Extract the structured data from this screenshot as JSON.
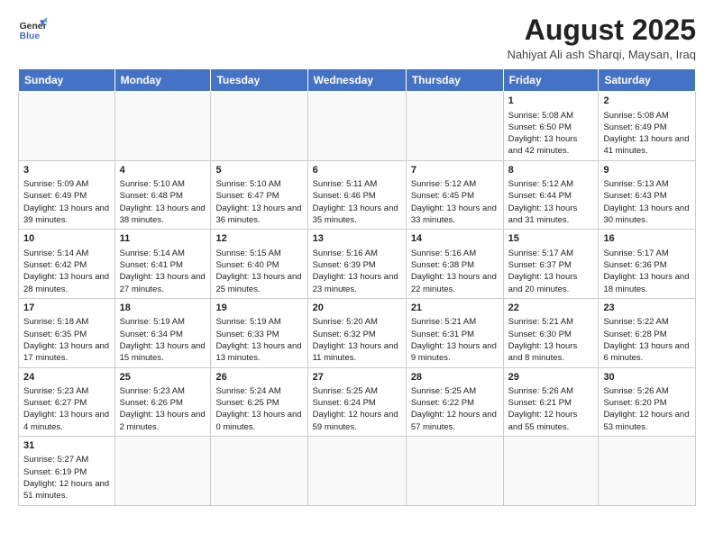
{
  "header": {
    "logo_general": "General",
    "logo_blue": "Blue",
    "title": "August 2025",
    "subtitle": "Nahiyat Ali ash Sharqi, Maysan, Iraq"
  },
  "days_of_week": [
    "Sunday",
    "Monday",
    "Tuesday",
    "Wednesday",
    "Thursday",
    "Friday",
    "Saturday"
  ],
  "weeks": [
    [
      {
        "day": "",
        "info": ""
      },
      {
        "day": "",
        "info": ""
      },
      {
        "day": "",
        "info": ""
      },
      {
        "day": "",
        "info": ""
      },
      {
        "day": "",
        "info": ""
      },
      {
        "day": "1",
        "info": "Sunrise: 5:08 AM\nSunset: 6:50 PM\nDaylight: 13 hours and 42 minutes."
      },
      {
        "day": "2",
        "info": "Sunrise: 5:08 AM\nSunset: 6:49 PM\nDaylight: 13 hours and 41 minutes."
      }
    ],
    [
      {
        "day": "3",
        "info": "Sunrise: 5:09 AM\nSunset: 6:49 PM\nDaylight: 13 hours and 39 minutes."
      },
      {
        "day": "4",
        "info": "Sunrise: 5:10 AM\nSunset: 6:48 PM\nDaylight: 13 hours and 38 minutes."
      },
      {
        "day": "5",
        "info": "Sunrise: 5:10 AM\nSunset: 6:47 PM\nDaylight: 13 hours and 36 minutes."
      },
      {
        "day": "6",
        "info": "Sunrise: 5:11 AM\nSunset: 6:46 PM\nDaylight: 13 hours and 35 minutes."
      },
      {
        "day": "7",
        "info": "Sunrise: 5:12 AM\nSunset: 6:45 PM\nDaylight: 13 hours and 33 minutes."
      },
      {
        "day": "8",
        "info": "Sunrise: 5:12 AM\nSunset: 6:44 PM\nDaylight: 13 hours and 31 minutes."
      },
      {
        "day": "9",
        "info": "Sunrise: 5:13 AM\nSunset: 6:43 PM\nDaylight: 13 hours and 30 minutes."
      }
    ],
    [
      {
        "day": "10",
        "info": "Sunrise: 5:14 AM\nSunset: 6:42 PM\nDaylight: 13 hours and 28 minutes."
      },
      {
        "day": "11",
        "info": "Sunrise: 5:14 AM\nSunset: 6:41 PM\nDaylight: 13 hours and 27 minutes."
      },
      {
        "day": "12",
        "info": "Sunrise: 5:15 AM\nSunset: 6:40 PM\nDaylight: 13 hours and 25 minutes."
      },
      {
        "day": "13",
        "info": "Sunrise: 5:16 AM\nSunset: 6:39 PM\nDaylight: 13 hours and 23 minutes."
      },
      {
        "day": "14",
        "info": "Sunrise: 5:16 AM\nSunset: 6:38 PM\nDaylight: 13 hours and 22 minutes."
      },
      {
        "day": "15",
        "info": "Sunrise: 5:17 AM\nSunset: 6:37 PM\nDaylight: 13 hours and 20 minutes."
      },
      {
        "day": "16",
        "info": "Sunrise: 5:17 AM\nSunset: 6:36 PM\nDaylight: 13 hours and 18 minutes."
      }
    ],
    [
      {
        "day": "17",
        "info": "Sunrise: 5:18 AM\nSunset: 6:35 PM\nDaylight: 13 hours and 17 minutes."
      },
      {
        "day": "18",
        "info": "Sunrise: 5:19 AM\nSunset: 6:34 PM\nDaylight: 13 hours and 15 minutes."
      },
      {
        "day": "19",
        "info": "Sunrise: 5:19 AM\nSunset: 6:33 PM\nDaylight: 13 hours and 13 minutes."
      },
      {
        "day": "20",
        "info": "Sunrise: 5:20 AM\nSunset: 6:32 PM\nDaylight: 13 hours and 11 minutes."
      },
      {
        "day": "21",
        "info": "Sunrise: 5:21 AM\nSunset: 6:31 PM\nDaylight: 13 hours and 9 minutes."
      },
      {
        "day": "22",
        "info": "Sunrise: 5:21 AM\nSunset: 6:30 PM\nDaylight: 13 hours and 8 minutes."
      },
      {
        "day": "23",
        "info": "Sunrise: 5:22 AM\nSunset: 6:28 PM\nDaylight: 13 hours and 6 minutes."
      }
    ],
    [
      {
        "day": "24",
        "info": "Sunrise: 5:23 AM\nSunset: 6:27 PM\nDaylight: 13 hours and 4 minutes."
      },
      {
        "day": "25",
        "info": "Sunrise: 5:23 AM\nSunset: 6:26 PM\nDaylight: 13 hours and 2 minutes."
      },
      {
        "day": "26",
        "info": "Sunrise: 5:24 AM\nSunset: 6:25 PM\nDaylight: 13 hours and 0 minutes."
      },
      {
        "day": "27",
        "info": "Sunrise: 5:25 AM\nSunset: 6:24 PM\nDaylight: 12 hours and 59 minutes."
      },
      {
        "day": "28",
        "info": "Sunrise: 5:25 AM\nSunset: 6:22 PM\nDaylight: 12 hours and 57 minutes."
      },
      {
        "day": "29",
        "info": "Sunrise: 5:26 AM\nSunset: 6:21 PM\nDaylight: 12 hours and 55 minutes."
      },
      {
        "day": "30",
        "info": "Sunrise: 5:26 AM\nSunset: 6:20 PM\nDaylight: 12 hours and 53 minutes."
      }
    ],
    [
      {
        "day": "31",
        "info": "Sunrise: 5:27 AM\nSunset: 6:19 PM\nDaylight: 12 hours and 51 minutes."
      },
      {
        "day": "",
        "info": ""
      },
      {
        "day": "",
        "info": ""
      },
      {
        "day": "",
        "info": ""
      },
      {
        "day": "",
        "info": ""
      },
      {
        "day": "",
        "info": ""
      },
      {
        "day": "",
        "info": ""
      }
    ]
  ]
}
